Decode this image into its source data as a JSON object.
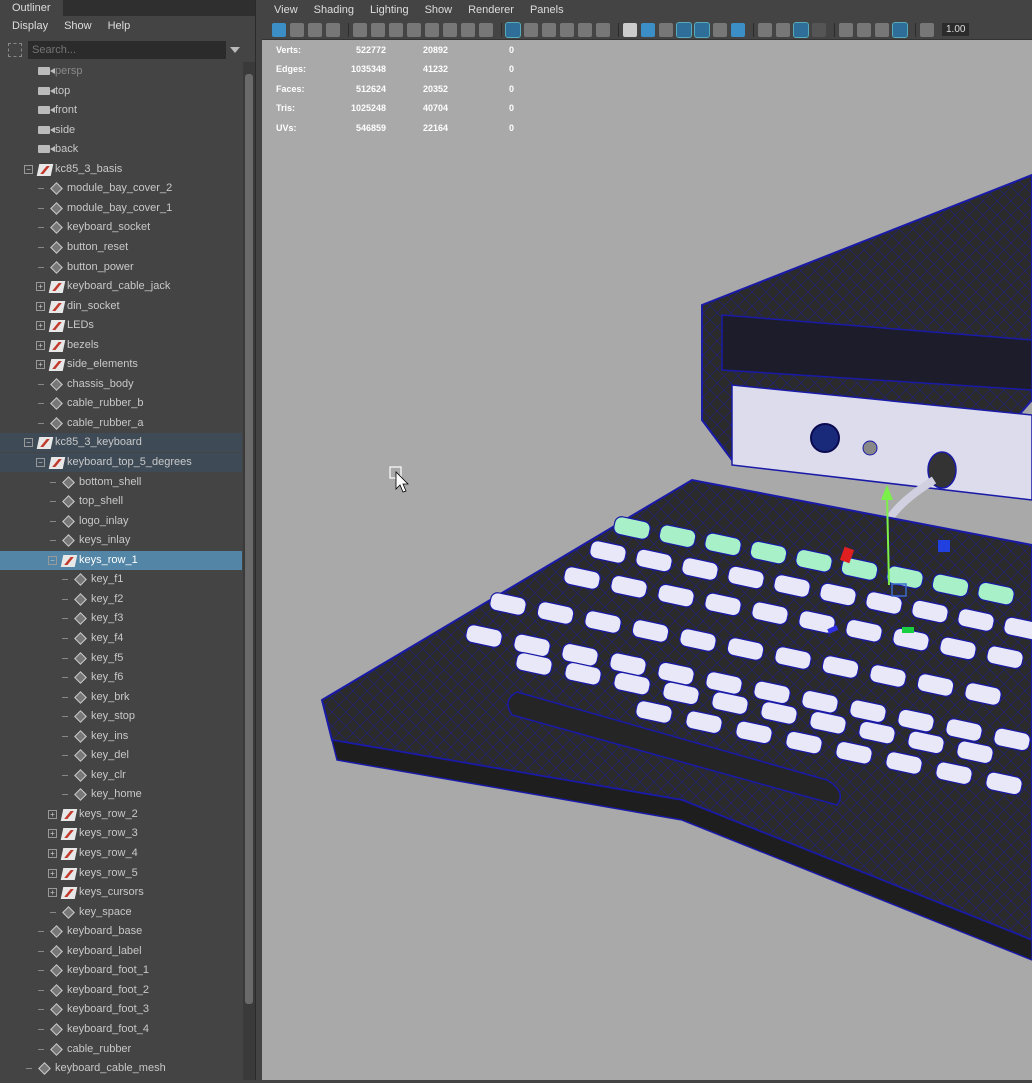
{
  "outliner": {
    "tab_label": "Outliner",
    "menu": [
      "Display",
      "Show",
      "Help"
    ],
    "search_placeholder": "Search...",
    "items": [
      {
        "label": "persp",
        "icon": "camera-icon",
        "depth": 0,
        "expander": "none",
        "dim": true
      },
      {
        "label": "top",
        "icon": "camera-icon",
        "depth": 0,
        "expander": "none"
      },
      {
        "label": "front",
        "icon": "camera-icon",
        "depth": 0,
        "expander": "none"
      },
      {
        "label": "side",
        "icon": "camera-icon",
        "depth": 0,
        "expander": "none"
      },
      {
        "label": "back",
        "icon": "camera-icon",
        "depth": 0,
        "expander": "none"
      },
      {
        "label": "kc85_3_basis",
        "icon": "group-icon",
        "depth": 0,
        "expander": "minus"
      },
      {
        "label": "module_bay_cover_2",
        "icon": "mesh-icon",
        "depth": 1,
        "expander": "none"
      },
      {
        "label": "module_bay_cover_1",
        "icon": "mesh-icon",
        "depth": 1,
        "expander": "none"
      },
      {
        "label": "keyboard_socket",
        "icon": "mesh-icon",
        "depth": 1,
        "expander": "none"
      },
      {
        "label": "button_reset",
        "icon": "mesh-icon",
        "depth": 1,
        "expander": "none"
      },
      {
        "label": "button_power",
        "icon": "mesh-icon",
        "depth": 1,
        "expander": "none"
      },
      {
        "label": "keyboard_cable_jack",
        "icon": "group-icon",
        "depth": 1,
        "expander": "plus"
      },
      {
        "label": "din_socket",
        "icon": "group-icon",
        "depth": 1,
        "expander": "plus"
      },
      {
        "label": "LEDs",
        "icon": "group-icon",
        "depth": 1,
        "expander": "plus"
      },
      {
        "label": "bezels",
        "icon": "group-icon",
        "depth": 1,
        "expander": "plus"
      },
      {
        "label": "side_elements",
        "icon": "group-icon",
        "depth": 1,
        "expander": "plus"
      },
      {
        "label": "chassis_body",
        "icon": "mesh-icon",
        "depth": 1,
        "expander": "none"
      },
      {
        "label": "cable_rubber_b",
        "icon": "mesh-icon",
        "depth": 1,
        "expander": "none"
      },
      {
        "label": "cable_rubber_a",
        "icon": "mesh-icon",
        "depth": 1,
        "expander": "none"
      },
      {
        "label": "kc85_3_keyboard",
        "icon": "group-icon",
        "depth": 0,
        "expander": "minus",
        "state": "hl"
      },
      {
        "label": "keyboard_top_5_degrees",
        "icon": "group-icon",
        "depth": 1,
        "expander": "minus",
        "state": "hl"
      },
      {
        "label": "bottom_shell",
        "icon": "mesh-icon",
        "depth": 2,
        "expander": "none"
      },
      {
        "label": "top_shell",
        "icon": "mesh-icon",
        "depth": 2,
        "expander": "none"
      },
      {
        "label": "logo_inlay",
        "icon": "mesh-icon",
        "depth": 2,
        "expander": "none"
      },
      {
        "label": "keys_inlay",
        "icon": "mesh-icon",
        "depth": 2,
        "expander": "none"
      },
      {
        "label": "keys_row_1",
        "icon": "group-icon",
        "depth": 2,
        "expander": "minus",
        "state": "sel"
      },
      {
        "label": "key_f1",
        "icon": "mesh-icon",
        "depth": 3,
        "expander": "none"
      },
      {
        "label": "key_f2",
        "icon": "mesh-icon",
        "depth": 3,
        "expander": "none"
      },
      {
        "label": "key_f3",
        "icon": "mesh-icon",
        "depth": 3,
        "expander": "none"
      },
      {
        "label": "key_f4",
        "icon": "mesh-icon",
        "depth": 3,
        "expander": "none"
      },
      {
        "label": "key_f5",
        "icon": "mesh-icon",
        "depth": 3,
        "expander": "none"
      },
      {
        "label": "key_f6",
        "icon": "mesh-icon",
        "depth": 3,
        "expander": "none"
      },
      {
        "label": "key_brk",
        "icon": "mesh-icon",
        "depth": 3,
        "expander": "none"
      },
      {
        "label": "key_stop",
        "icon": "mesh-icon",
        "depth": 3,
        "expander": "none"
      },
      {
        "label": "key_ins",
        "icon": "mesh-icon",
        "depth": 3,
        "expander": "none"
      },
      {
        "label": "key_del",
        "icon": "mesh-icon",
        "depth": 3,
        "expander": "none"
      },
      {
        "label": "key_clr",
        "icon": "mesh-icon",
        "depth": 3,
        "expander": "none"
      },
      {
        "label": "key_home",
        "icon": "mesh-icon",
        "depth": 3,
        "expander": "none"
      },
      {
        "label": "keys_row_2",
        "icon": "group-icon",
        "depth": 2,
        "expander": "plus"
      },
      {
        "label": "keys_row_3",
        "icon": "group-icon",
        "depth": 2,
        "expander": "plus"
      },
      {
        "label": "keys_row_4",
        "icon": "group-icon",
        "depth": 2,
        "expander": "plus"
      },
      {
        "label": "keys_row_5",
        "icon": "group-icon",
        "depth": 2,
        "expander": "plus"
      },
      {
        "label": "keys_cursors",
        "icon": "group-icon",
        "depth": 2,
        "expander": "plus"
      },
      {
        "label": "key_space",
        "icon": "mesh-icon",
        "depth": 2,
        "expander": "none"
      },
      {
        "label": "keyboard_base",
        "icon": "mesh-icon",
        "depth": 1,
        "expander": "none"
      },
      {
        "label": "keyboard_label",
        "icon": "mesh-icon",
        "depth": 1,
        "expander": "none"
      },
      {
        "label": "keyboard_foot_1",
        "icon": "mesh-icon",
        "depth": 1,
        "expander": "none"
      },
      {
        "label": "keyboard_foot_2",
        "icon": "mesh-icon",
        "depth": 1,
        "expander": "none"
      },
      {
        "label": "keyboard_foot_3",
        "icon": "mesh-icon",
        "depth": 1,
        "expander": "none"
      },
      {
        "label": "keyboard_foot_4",
        "icon": "mesh-icon",
        "depth": 1,
        "expander": "none"
      },
      {
        "label": "cable_rubber",
        "icon": "mesh-icon",
        "depth": 1,
        "expander": "none"
      },
      {
        "label": "keyboard_cable_mesh",
        "icon": "mesh-icon",
        "depth": 0,
        "expander": "none"
      }
    ]
  },
  "viewport": {
    "menu": [
      "View",
      "Shading",
      "Lighting",
      "Show",
      "Renderer",
      "Panels"
    ],
    "zoom": "1.00",
    "hud": [
      {
        "label": "Verts:",
        "total": "522772",
        "selected": "20892",
        "extra": "0"
      },
      {
        "label": "Edges:",
        "total": "1035348",
        "selected": "41232",
        "extra": "0"
      },
      {
        "label": "Faces:",
        "total": "512624",
        "selected": "20352",
        "extra": "0"
      },
      {
        "label": "Tris:",
        "total": "1025248",
        "selected": "40704",
        "extra": "0"
      },
      {
        "label": "UVs:",
        "total": "546859",
        "selected": "22164",
        "extra": "0"
      }
    ],
    "colors": {
      "wireframe": "#1a1aa8",
      "selected_key": "#a8f0c8",
      "key": "#e8e8f8",
      "body": "#2a2a2a",
      "background": "#a9a9a9"
    }
  }
}
